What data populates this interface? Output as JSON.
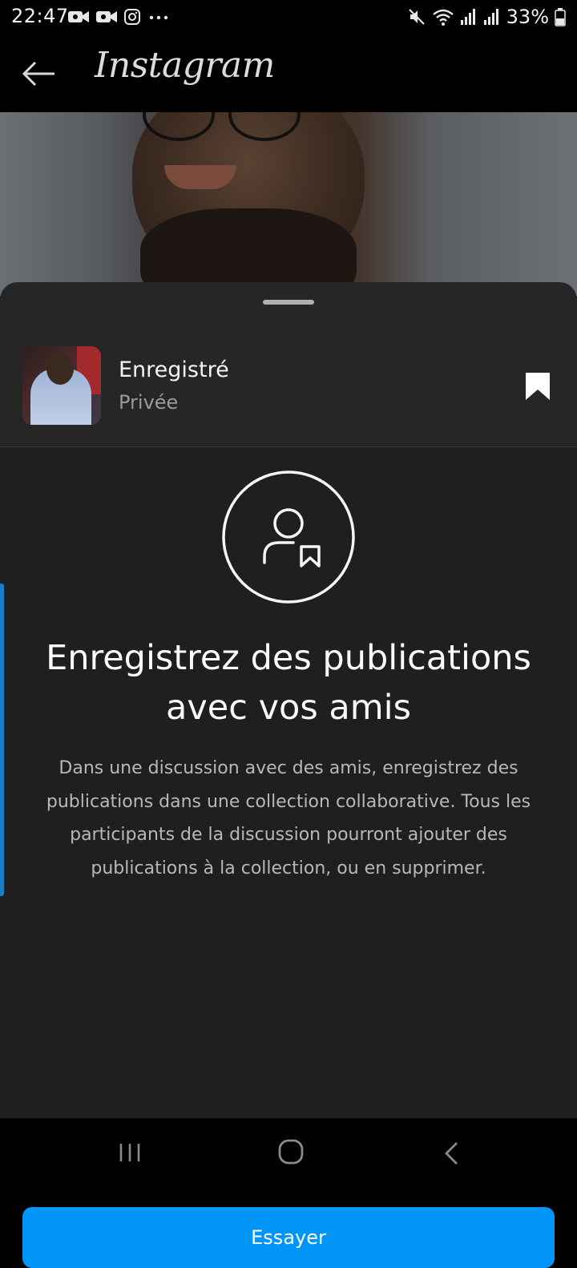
{
  "status_bar": {
    "time": "22:47",
    "battery": "33%",
    "left_icons": [
      "video-icon",
      "video-icon",
      "instagram-icon",
      "more-dots-icon"
    ],
    "right_icons": [
      "mute-icon",
      "wifi-icon",
      "signal-icon",
      "signal-icon",
      "battery-icon"
    ]
  },
  "app_bar": {
    "title": "Instagram"
  },
  "sheet": {
    "collection": {
      "name": "Enregistré",
      "privacy": "Privée"
    },
    "headline": "Enregistrez des publications avec vos amis",
    "description": "Dans une discussion avec des amis, enregistrez des publications dans une collection collaborative. Tous les participants de la discussion pourront ajouter des publications à la collection, ou en supprimer.",
    "button_label": "Essayer"
  },
  "colors": {
    "accent": "#0095f6",
    "sheet_bg": "#262626",
    "content_bg": "#1f1f1f"
  }
}
